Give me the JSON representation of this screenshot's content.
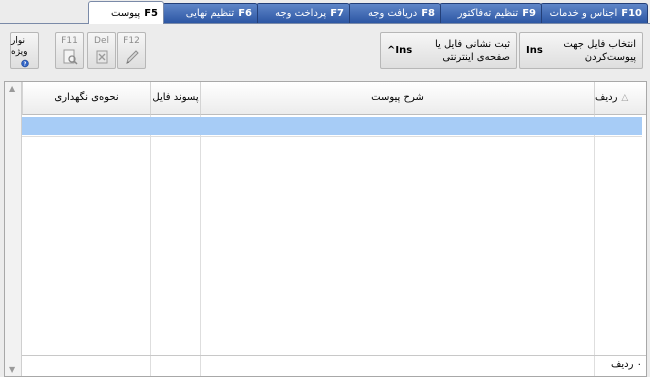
{
  "tabs": [
    {
      "key": "F5",
      "label": "پیوست",
      "active": true
    },
    {
      "key": "F6",
      "label": "تنظیم نهایی",
      "active": false
    },
    {
      "key": "F7",
      "label": "پرداخت وجه",
      "active": false
    },
    {
      "key": "F8",
      "label": "دریافت وجه",
      "active": false
    },
    {
      "key": "F9",
      "label": "تنظیم تەفاکتور",
      "active": false
    },
    {
      "key": "F10",
      "label": "اجناس و خدمات",
      "active": false
    }
  ],
  "toolbar": {
    "special_bar_label": "نوار ویژه",
    "f11_label": "F11",
    "del_label": "Del",
    "f12_label": "F12",
    "register_link": {
      "text": "ثبت نشانی فایل یا صفحه‌ی اینترنتی",
      "key": "^Ins"
    },
    "select_file": {
      "text": "انتخاب فایل جهت پیوست‌کردن",
      "key": "Ins"
    }
  },
  "grid": {
    "columns": {
      "row": "ردیف",
      "description": "شرح پیوست",
      "extension": "پسوند فایل",
      "storage": "نحوه‌ی نگهداری"
    },
    "sort_indicator": "△",
    "footer_count": "۰ ردیف"
  }
}
